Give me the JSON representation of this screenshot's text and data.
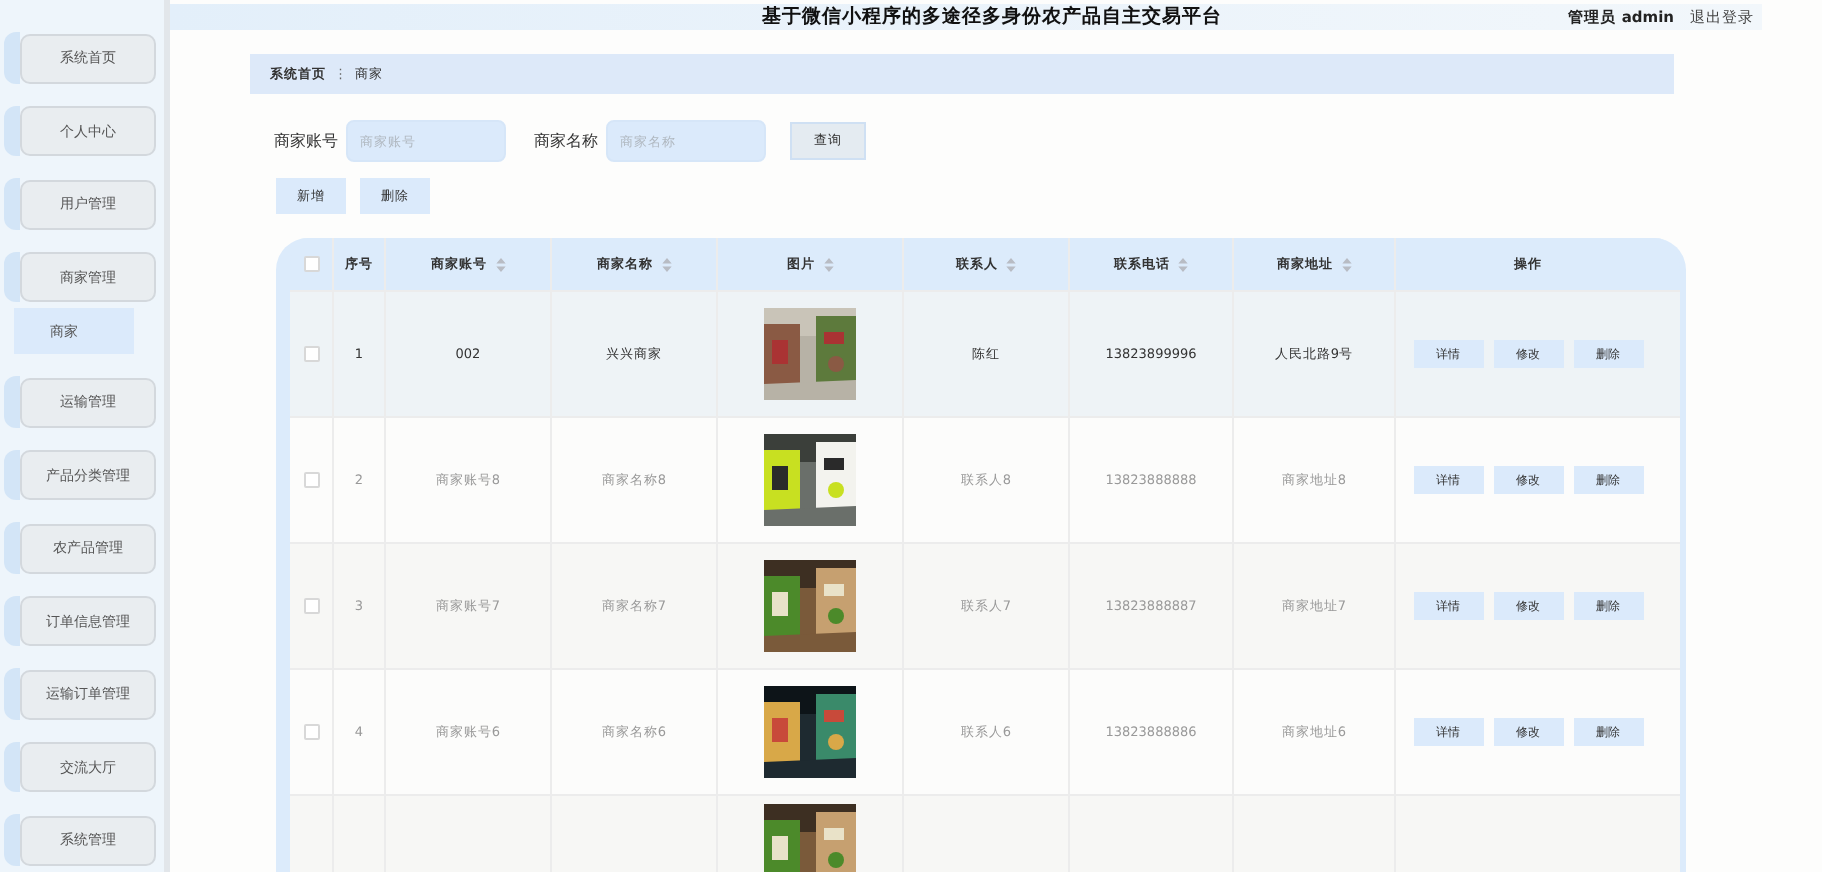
{
  "sidebar": {
    "items": [
      {
        "label": "系统首页"
      },
      {
        "label": "个人中心"
      },
      {
        "label": "用户管理"
      },
      {
        "label": "商家管理",
        "children": [
          {
            "label": "商家",
            "selected": true
          }
        ]
      },
      {
        "label": "运输管理"
      },
      {
        "label": "产品分类管理"
      },
      {
        "label": "农产品管理"
      },
      {
        "label": "订单信息管理"
      },
      {
        "label": "运输订单管理"
      },
      {
        "label": "交流大厅"
      },
      {
        "label": "系统管理"
      }
    ]
  },
  "header": {
    "title": "基于微信小程序的多途径多身份农产品自主交易平台",
    "user_role": "管理员",
    "username": "admin",
    "logout": "退出登录"
  },
  "breadcrumb": {
    "items": [
      "系统首页",
      "商家"
    ],
    "separator": "⋮"
  },
  "search": {
    "fields": [
      {
        "label": "商家账号",
        "placeholder": "商家账号"
      },
      {
        "label": "商家名称",
        "placeholder": "商家名称"
      }
    ],
    "button": "查询"
  },
  "actions": [
    "新增",
    "删除"
  ],
  "table": {
    "columns": [
      {
        "label": "序号",
        "sortable": false
      },
      {
        "label": "商家账号",
        "sortable": true
      },
      {
        "label": "商家名称",
        "sortable": true
      },
      {
        "label": "图片",
        "sortable": true
      },
      {
        "label": "联系人",
        "sortable": true
      },
      {
        "label": "联系电话",
        "sortable": true
      },
      {
        "label": "商家地址",
        "sortable": true
      },
      {
        "label": "操作",
        "sortable": false
      }
    ],
    "header_checked": false,
    "rows": [
      {
        "checked": false,
        "highlighted": true,
        "cells": [
          "1",
          "002",
          "兴兴商家",
          "",
          "陈红",
          "13823899996",
          "人民北路9号"
        ],
        "buttons": [
          "详情",
          "修改",
          "删除"
        ]
      },
      {
        "checked": false,
        "highlighted": false,
        "cells": [
          "2",
          "商家账号8",
          "商家名称8",
          "",
          "联系人8",
          "13823888888",
          "商家地址8"
        ],
        "buttons": [
          "详情",
          "修改",
          "删除"
        ]
      },
      {
        "checked": false,
        "highlighted": false,
        "cells": [
          "3",
          "商家账号7",
          "商家名称7",
          "",
          "联系人7",
          "13823888887",
          "商家地址7"
        ],
        "buttons": [
          "详情",
          "修改",
          "删除"
        ]
      },
      {
        "checked": false,
        "highlighted": false,
        "cells": [
          "4",
          "商家账号6",
          "商家名称6",
          "",
          "联系人6",
          "13823888886",
          "商家地址6"
        ],
        "buttons": [
          "详情",
          "修改",
          "删除"
        ]
      }
    ]
  }
}
